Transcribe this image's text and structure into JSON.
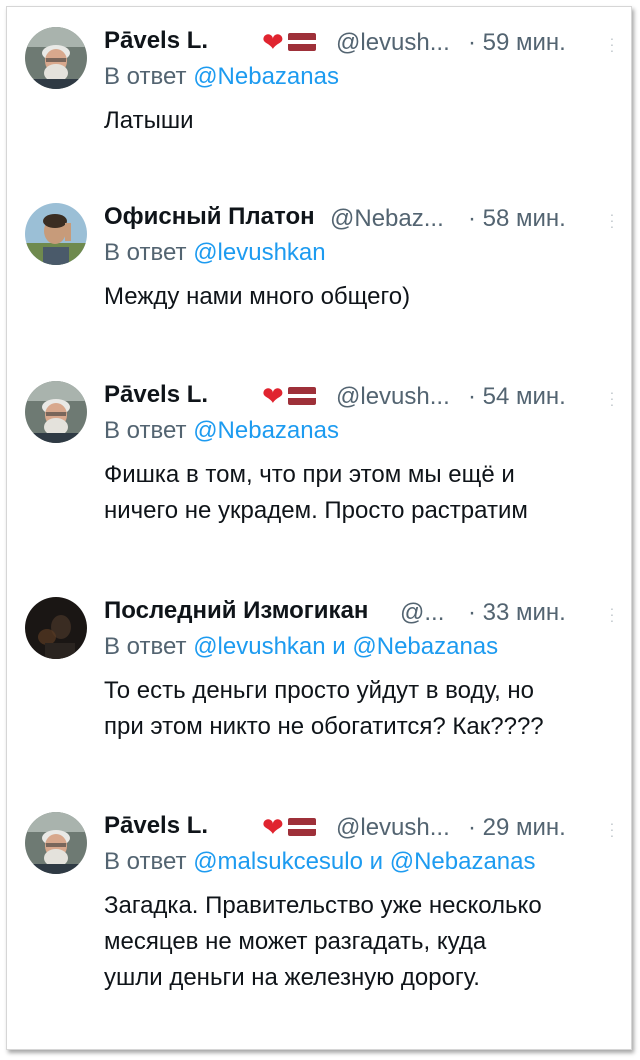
{
  "tweets": [
    {
      "name": "Pāvels L.",
      "has_emoji": true,
      "handle": "@levush...",
      "time": "· 59 мин.",
      "reply_prefix": "В ответ",
      "mention1": "@Nebazanas",
      "conj": "",
      "mention2": "",
      "lines": [
        "Латыши"
      ],
      "avatar": "bearded-man-avatar"
    },
    {
      "name": "Офисный Платон",
      "has_emoji": false,
      "handle": "@Nebaz...",
      "time": "· 58 мин.",
      "reply_prefix": "В ответ",
      "mention1": "@levushkan",
      "conj": "",
      "mention2": "",
      "lines": [
        "Между нами много общего)"
      ],
      "avatar": "man-outdoor-avatar"
    },
    {
      "name": "Pāvels L.",
      "has_emoji": true,
      "handle": "@levush...",
      "time": "· 54 мин.",
      "reply_prefix": "В ответ",
      "mention1": "@Nebazanas",
      "conj": "",
      "mention2": "",
      "lines": [
        "Фишка в том, что при этом мы ещё и",
        "ничего не украдем. Просто растратим"
      ],
      "avatar": "bearded-man-avatar"
    },
    {
      "name": "Последний Измогикан",
      "has_emoji": false,
      "handle": "@...",
      "time": "· 33 мин.",
      "reply_prefix": "В ответ",
      "mention1": "@levushkan",
      "conj": "и",
      "mention2": "@Nebazanas",
      "lines": [
        "То есть деньги просто уйдут в воду, но",
        "при этом никто не обогатится? Как????"
      ],
      "avatar": "dark-portrait-avatar"
    },
    {
      "name": "Pāvels L.",
      "has_emoji": true,
      "handle": "@levush...",
      "time": "· 29 мин.",
      "reply_prefix": "В ответ",
      "mention1": "@malsukcesulo",
      "conj": "и",
      "mention2": "@Nebazanas",
      "lines": [
        "Загадка. Правительство уже несколько",
        "месяцев не может разгадать, куда",
        "ушли деньги на железную дорогу."
      ],
      "avatar": "bearded-man-avatar"
    }
  ],
  "colors": {
    "name": "#0f1419",
    "secondary": "#536471",
    "mention": "#1d9bf0",
    "heart": "#e0242f",
    "flag": "#9e3039"
  }
}
